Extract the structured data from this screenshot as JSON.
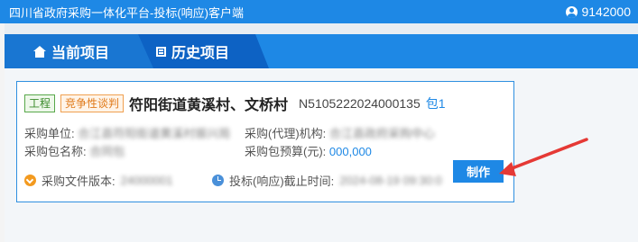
{
  "window": {
    "title": "四川省政府采购一体化平台-投标(响应)客户端",
    "user_id": "9142000"
  },
  "tabs": [
    {
      "label": "当前项目",
      "active": true,
      "icon": "house-icon"
    },
    {
      "label": "历史项目",
      "active": false,
      "icon": "list-icon"
    }
  ],
  "project": {
    "tags": [
      "工程",
      "竞争性谈判"
    ],
    "title": "符阳街道黄溪村、文桥村",
    "code": "N5105222024000135",
    "package": "包1",
    "buyer_label": "采购单位:",
    "buyer_value": "合江县符阳街道黄溪村振兴局",
    "agency_label": "采购(代理)机构:",
    "agency_value": "合江县政府采购中心",
    "package_name_label": "采购包名称:",
    "package_name_value": "合同包",
    "budget_label": "采购包预算(元):",
    "budget_value": "000,000",
    "doc_version_label": "采购文件版本:",
    "doc_version_value": "24000001",
    "deadline_label": "投标(响应)截止时间:",
    "deadline_value": "2024-08-19 09:30:0",
    "action_label": "制作"
  },
  "colors": {
    "primary": "#1e88e5",
    "tag_engineering": "#58a84a",
    "tag_negotiation": "#f0a050",
    "annotation_arrow": "#e53935"
  }
}
